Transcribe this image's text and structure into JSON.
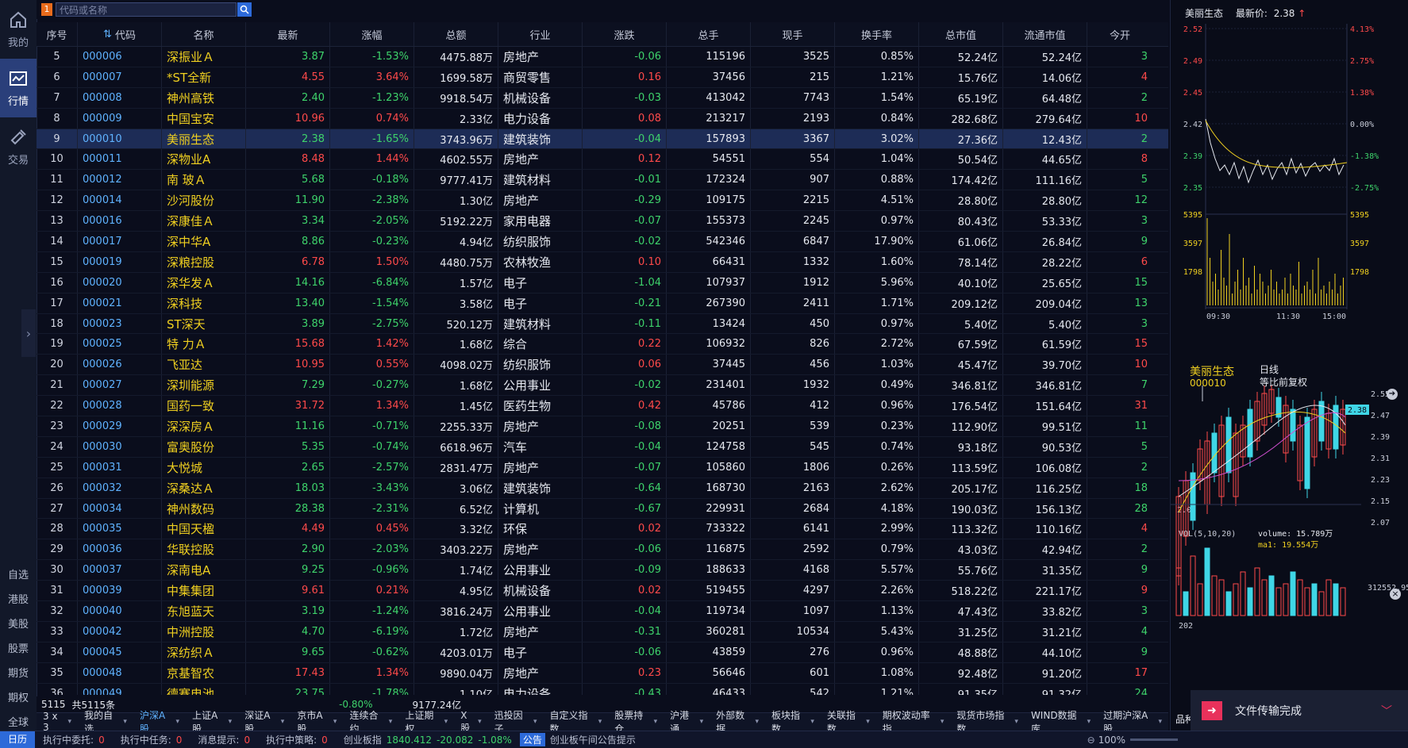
{
  "nav": {
    "items": [
      {
        "label": "我的",
        "icon": "home-icon"
      },
      {
        "label": "行情",
        "icon": "chart-icon"
      },
      {
        "label": "交易",
        "icon": "trade-icon"
      }
    ],
    "markets": [
      "自选",
      "港股",
      "美股",
      "股票",
      "期货",
      "期权",
      "全球"
    ]
  },
  "topbar": {
    "logo": "1",
    "search_placeholder": "代码或名称"
  },
  "table": {
    "headers": [
      "序号",
      "代码",
      "名称",
      "最新",
      "涨幅",
      "总额",
      "行业",
      "涨跌",
      "总手",
      "现手",
      "换手率",
      "总市值",
      "流通市值",
      "今开"
    ],
    "rows": [
      {
        "no": "5",
        "code": "000006",
        "name": "深振业Ａ",
        "last": "3.87",
        "pct": "-1.53%",
        "amount": "4475.88万",
        "industry": "房地产",
        "chg": "-0.06",
        "vol": "115196",
        "cur": "3525",
        "turn": "0.85%",
        "mcap": "52.24亿",
        "fcap": "52.24亿",
        "open": "3",
        "dir": "down"
      },
      {
        "no": "6",
        "code": "000007",
        "name": "*ST全新",
        "last": "4.55",
        "pct": "3.64%",
        "amount": "1699.58万",
        "industry": "商贸零售",
        "chg": "0.16",
        "vol": "37456",
        "cur": "215",
        "turn": "1.21%",
        "mcap": "15.76亿",
        "fcap": "14.06亿",
        "open": "4",
        "dir": "up"
      },
      {
        "no": "7",
        "code": "000008",
        "name": "神州高铁",
        "last": "2.40",
        "pct": "-1.23%",
        "amount": "9918.54万",
        "industry": "机械设备",
        "chg": "-0.03",
        "vol": "413042",
        "cur": "7743",
        "turn": "1.54%",
        "mcap": "65.19亿",
        "fcap": "64.48亿",
        "open": "2",
        "dir": "down"
      },
      {
        "no": "8",
        "code": "000009",
        "name": "中国宝安",
        "last": "10.96",
        "pct": "0.74%",
        "amount": "2.33亿",
        "industry": "电力设备",
        "chg": "0.08",
        "vol": "213217",
        "cur": "2193",
        "turn": "0.84%",
        "mcap": "282.68亿",
        "fcap": "279.64亿",
        "open": "10",
        "dir": "up"
      },
      {
        "no": "9",
        "code": "000010",
        "name": "美丽生态",
        "last": "2.38",
        "pct": "-1.65%",
        "amount": "3743.96万",
        "industry": "建筑装饰",
        "chg": "-0.04",
        "vol": "157893",
        "cur": "3367",
        "turn": "3.02%",
        "mcap": "27.36亿",
        "fcap": "12.43亿",
        "open": "2",
        "dir": "down"
      },
      {
        "no": "10",
        "code": "000011",
        "name": "深物业A",
        "last": "8.48",
        "pct": "1.44%",
        "amount": "4602.55万",
        "industry": "房地产",
        "chg": "0.12",
        "vol": "54551",
        "cur": "554",
        "turn": "1.04%",
        "mcap": "50.54亿",
        "fcap": "44.65亿",
        "open": "8",
        "dir": "up"
      },
      {
        "no": "11",
        "code": "000012",
        "name": "南 玻Ａ",
        "last": "5.68",
        "pct": "-0.18%",
        "amount": "9777.41万",
        "industry": "建筑材料",
        "chg": "-0.01",
        "vol": "172324",
        "cur": "907",
        "turn": "0.88%",
        "mcap": "174.42亿",
        "fcap": "111.16亿",
        "open": "5",
        "dir": "down"
      },
      {
        "no": "12",
        "code": "000014",
        "name": "沙河股份",
        "last": "11.90",
        "pct": "-2.38%",
        "amount": "1.30亿",
        "industry": "房地产",
        "chg": "-0.29",
        "vol": "109175",
        "cur": "2215",
        "turn": "4.51%",
        "mcap": "28.80亿",
        "fcap": "28.80亿",
        "open": "12",
        "dir": "down"
      },
      {
        "no": "13",
        "code": "000016",
        "name": "深康佳Ａ",
        "last": "3.34",
        "pct": "-2.05%",
        "amount": "5192.22万",
        "industry": "家用电器",
        "chg": "-0.07",
        "vol": "155373",
        "cur": "2245",
        "turn": "0.97%",
        "mcap": "80.43亿",
        "fcap": "53.33亿",
        "open": "3",
        "dir": "down"
      },
      {
        "no": "14",
        "code": "000017",
        "name": "深中华A",
        "last": "8.86",
        "pct": "-0.23%",
        "amount": "4.94亿",
        "industry": "纺织服饰",
        "chg": "-0.02",
        "vol": "542346",
        "cur": "6847",
        "turn": "17.90%",
        "mcap": "61.06亿",
        "fcap": "26.84亿",
        "open": "9",
        "dir": "down"
      },
      {
        "no": "15",
        "code": "000019",
        "name": "深粮控股",
        "last": "6.78",
        "pct": "1.50%",
        "amount": "4480.75万",
        "industry": "农林牧渔",
        "chg": "0.10",
        "vol": "66431",
        "cur": "1332",
        "turn": "1.60%",
        "mcap": "78.14亿",
        "fcap": "28.22亿",
        "open": "6",
        "dir": "up"
      },
      {
        "no": "16",
        "code": "000020",
        "name": "深华发Ａ",
        "last": "14.16",
        "pct": "-6.84%",
        "amount": "1.57亿",
        "industry": "电子",
        "chg": "-1.04",
        "vol": "107937",
        "cur": "1912",
        "turn": "5.96%",
        "mcap": "40.10亿",
        "fcap": "25.65亿",
        "open": "15",
        "dir": "down"
      },
      {
        "no": "17",
        "code": "000021",
        "name": "深科技",
        "last": "13.40",
        "pct": "-1.54%",
        "amount": "3.58亿",
        "industry": "电子",
        "chg": "-0.21",
        "vol": "267390",
        "cur": "2411",
        "turn": "1.71%",
        "mcap": "209.12亿",
        "fcap": "209.04亿",
        "open": "13",
        "dir": "down"
      },
      {
        "no": "18",
        "code": "000023",
        "name": "ST深天",
        "last": "3.89",
        "pct": "-2.75%",
        "amount": "520.12万",
        "industry": "建筑材料",
        "chg": "-0.11",
        "vol": "13424",
        "cur": "450",
        "turn": "0.97%",
        "mcap": "5.40亿",
        "fcap": "5.40亿",
        "open": "3",
        "dir": "down"
      },
      {
        "no": "19",
        "code": "000025",
        "name": "特 力Ａ",
        "last": "15.68",
        "pct": "1.42%",
        "amount": "1.68亿",
        "industry": "综合",
        "chg": "0.22",
        "vol": "106932",
        "cur": "826",
        "turn": "2.72%",
        "mcap": "67.59亿",
        "fcap": "61.59亿",
        "open": "15",
        "dir": "up"
      },
      {
        "no": "20",
        "code": "000026",
        "name": "飞亚达",
        "last": "10.95",
        "pct": "0.55%",
        "amount": "4098.02万",
        "industry": "纺织服饰",
        "chg": "0.06",
        "vol": "37445",
        "cur": "456",
        "turn": "1.03%",
        "mcap": "45.47亿",
        "fcap": "39.70亿",
        "open": "10",
        "dir": "up"
      },
      {
        "no": "21",
        "code": "000027",
        "name": "深圳能源",
        "last": "7.29",
        "pct": "-0.27%",
        "amount": "1.68亿",
        "industry": "公用事业",
        "chg": "-0.02",
        "vol": "231401",
        "cur": "1932",
        "turn": "0.49%",
        "mcap": "346.81亿",
        "fcap": "346.81亿",
        "open": "7",
        "dir": "down"
      },
      {
        "no": "22",
        "code": "000028",
        "name": "国药一致",
        "last": "31.72",
        "pct": "1.34%",
        "amount": "1.45亿",
        "industry": "医药生物",
        "chg": "0.42",
        "vol": "45786",
        "cur": "412",
        "turn": "0.96%",
        "mcap": "176.54亿",
        "fcap": "151.64亿",
        "open": "31",
        "dir": "up"
      },
      {
        "no": "23",
        "code": "000029",
        "name": "深深房Ａ",
        "last": "11.16",
        "pct": "-0.71%",
        "amount": "2255.33万",
        "industry": "房地产",
        "chg": "-0.08",
        "vol": "20251",
        "cur": "539",
        "turn": "0.23%",
        "mcap": "112.90亿",
        "fcap": "99.51亿",
        "open": "11",
        "dir": "down"
      },
      {
        "no": "24",
        "code": "000030",
        "name": "富奥股份",
        "last": "5.35",
        "pct": "-0.74%",
        "amount": "6618.96万",
        "industry": "汽车",
        "chg": "-0.04",
        "vol": "124758",
        "cur": "545",
        "turn": "0.74%",
        "mcap": "93.18亿",
        "fcap": "90.53亿",
        "open": "5",
        "dir": "down"
      },
      {
        "no": "25",
        "code": "000031",
        "name": "大悦城",
        "last": "2.65",
        "pct": "-2.57%",
        "amount": "2831.47万",
        "industry": "房地产",
        "chg": "-0.07",
        "vol": "105860",
        "cur": "1806",
        "turn": "0.26%",
        "mcap": "113.59亿",
        "fcap": "106.08亿",
        "open": "2",
        "dir": "down"
      },
      {
        "no": "26",
        "code": "000032",
        "name": "深桑达Ａ",
        "last": "18.03",
        "pct": "-3.43%",
        "amount": "3.06亿",
        "industry": "建筑装饰",
        "chg": "-0.64",
        "vol": "168730",
        "cur": "2163",
        "turn": "2.62%",
        "mcap": "205.17亿",
        "fcap": "116.25亿",
        "open": "18",
        "dir": "down"
      },
      {
        "no": "27",
        "code": "000034",
        "name": "神州数码",
        "last": "28.38",
        "pct": "-2.31%",
        "amount": "6.52亿",
        "industry": "计算机",
        "chg": "-0.67",
        "vol": "229931",
        "cur": "2684",
        "turn": "4.18%",
        "mcap": "190.03亿",
        "fcap": "156.13亿",
        "open": "28",
        "dir": "down"
      },
      {
        "no": "28",
        "code": "000035",
        "name": "中国天楹",
        "last": "4.49",
        "pct": "0.45%",
        "amount": "3.32亿",
        "industry": "环保",
        "chg": "0.02",
        "vol": "733322",
        "cur": "6141",
        "turn": "2.99%",
        "mcap": "113.32亿",
        "fcap": "110.16亿",
        "open": "4",
        "dir": "up"
      },
      {
        "no": "29",
        "code": "000036",
        "name": "华联控股",
        "last": "2.90",
        "pct": "-2.03%",
        "amount": "3403.22万",
        "industry": "房地产",
        "chg": "-0.06",
        "vol": "116875",
        "cur": "2592",
        "turn": "0.79%",
        "mcap": "43.03亿",
        "fcap": "42.94亿",
        "open": "2",
        "dir": "down"
      },
      {
        "no": "30",
        "code": "000037",
        "name": "深南电A",
        "last": "9.25",
        "pct": "-0.96%",
        "amount": "1.74亿",
        "industry": "公用事业",
        "chg": "-0.09",
        "vol": "188633",
        "cur": "4168",
        "turn": "5.57%",
        "mcap": "55.76亿",
        "fcap": "31.35亿",
        "open": "9",
        "dir": "down"
      },
      {
        "no": "31",
        "code": "000039",
        "name": "中集集团",
        "last": "9.61",
        "pct": "0.21%",
        "amount": "4.95亿",
        "industry": "机械设备",
        "chg": "0.02",
        "vol": "519455",
        "cur": "4297",
        "turn": "2.26%",
        "mcap": "518.22亿",
        "fcap": "221.17亿",
        "open": "9",
        "dir": "up"
      },
      {
        "no": "32",
        "code": "000040",
        "name": "东旭蓝天",
        "last": "3.19",
        "pct": "-1.24%",
        "amount": "3816.24万",
        "industry": "公用事业",
        "chg": "-0.04",
        "vol": "119734",
        "cur": "1097",
        "turn": "1.13%",
        "mcap": "47.43亿",
        "fcap": "33.82亿",
        "open": "3",
        "dir": "down"
      },
      {
        "no": "33",
        "code": "000042",
        "name": "中洲控股",
        "last": "4.70",
        "pct": "-6.19%",
        "amount": "1.72亿",
        "industry": "房地产",
        "chg": "-0.31",
        "vol": "360281",
        "cur": "10534",
        "turn": "5.43%",
        "mcap": "31.25亿",
        "fcap": "31.21亿",
        "open": "4",
        "dir": "down"
      },
      {
        "no": "34",
        "code": "000045",
        "name": "深纺织Ａ",
        "last": "9.65",
        "pct": "-0.62%",
        "amount": "4203.01万",
        "industry": "电子",
        "chg": "-0.06",
        "vol": "43859",
        "cur": "276",
        "turn": "0.96%",
        "mcap": "48.88亿",
        "fcap": "44.10亿",
        "open": "9",
        "dir": "down"
      },
      {
        "no": "35",
        "code": "000048",
        "name": "京基智农",
        "last": "17.43",
        "pct": "1.34%",
        "amount": "9890.04万",
        "industry": "房地产",
        "chg": "0.23",
        "vol": "56646",
        "cur": "601",
        "turn": "1.08%",
        "mcap": "92.48亿",
        "fcap": "91.20亿",
        "open": "17",
        "dir": "up"
      },
      {
        "no": "36",
        "code": "000049",
        "name": "德赛电池",
        "last": "23.75",
        "pct": "-1.78%",
        "amount": "1.10亿",
        "industry": "电力设备",
        "chg": "-0.43",
        "vol": "46433",
        "cur": "542",
        "turn": "1.21%",
        "mcap": "91.35亿",
        "fcap": "91.32亿",
        "open": "24",
        "dir": "down"
      }
    ],
    "selected_index": 4
  },
  "summary": {
    "count": "5115",
    "total_text": "共5115条",
    "avg_pct": "-0.80%",
    "total_amount": "9177.24亿"
  },
  "tabs": [
    "3 x 3",
    "我的自选",
    "沪深A股",
    "上证A股",
    "深证A股",
    "京市A股",
    "连续合约",
    "上证期权",
    "X股",
    "迅投因子",
    "自定义指数",
    "股票持仓",
    "沪港通",
    "外部数据",
    "板块指数",
    "关联指数",
    "期权波动率指",
    "现货市场指数",
    "WIND数据库",
    "过期沪深A股"
  ],
  "active_tab": 2,
  "statusbar": {
    "day": "日历",
    "delegate_label": "执行中委托:",
    "delegate_n": "0",
    "task_label": "执行中任务:",
    "task_n": "0",
    "msg_label": "消息提示:",
    "msg_n": "0",
    "strategy_label": "执行中策略:",
    "strategy_n": "0",
    "board": "创业板指",
    "board_value": "1840.412",
    "board_chg": "-20.082",
    "board_pct": "-1.08%",
    "notice_tag": "公告",
    "notice_text": "创业板午间公告提示",
    "zoom": "100%"
  },
  "right_panel": {
    "stock": "美丽生态",
    "last_price_label": "最新价:",
    "last_price": "2.38",
    "intraday": {
      "price_ticks": [
        "2.52",
        "2.49",
        "2.45",
        "2.42",
        "2.39",
        "2.35"
      ],
      "pct_ticks": [
        "4.13%",
        "2.75%",
        "1.38%",
        "0.00%",
        "-1.38%",
        "-2.75%"
      ],
      "vol_ticks": [
        "5395",
        "3597",
        "1798"
      ],
      "time_ticks": [
        "09:30",
        "11:30",
        "15:00"
      ]
    },
    "kline": {
      "name": "美丽生态",
      "code": "000010",
      "period": "日线",
      "adjust": "等比前复权",
      "high_mark": "2.58",
      "low_mark": "2.04",
      "price_ticks": [
        "2.55",
        "2.47",
        "2.39",
        "2.31",
        "2.23",
        "2.15",
        "2.07"
      ],
      "current_tag": "2.38",
      "vol_label": "VOL(5,10,20)",
      "volume_label": "volume: 15.789万",
      "ma1_label": "ma1: 19.554万",
      "vol_tick": "312552.95",
      "year_label": "202"
    },
    "tab_label": "品种"
  },
  "toast": {
    "text": "文件传输完成"
  }
}
